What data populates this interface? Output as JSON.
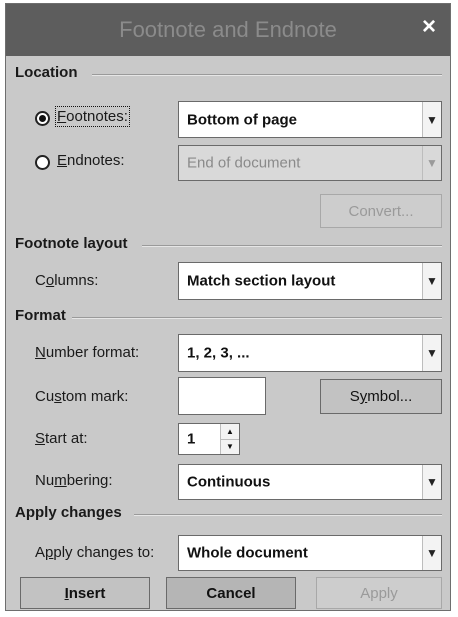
{
  "dialog": {
    "title": "Footnote and Endnote",
    "close_glyph": "×"
  },
  "location": {
    "section_label": "Location",
    "footnotes": {
      "label_first": "F",
      "label_rest": "ootnotes:",
      "selected": true,
      "value": "Bottom of page"
    },
    "endnotes": {
      "label_first": "E",
      "label_rest": "ndnotes:",
      "selected": false,
      "value": "End of document"
    },
    "convert_label": "Convert..."
  },
  "footnote_layout": {
    "section_label": "Footnote layout",
    "columns_label_first": "C",
    "columns_label_u": "o",
    "columns_label_rest": "lumns:",
    "columns_value": "Match section layout"
  },
  "format": {
    "section_label": "Format",
    "number_format_label_first": "N",
    "number_format_label_rest": "umber format:",
    "number_format_value": "1, 2, 3, ...",
    "custom_mark_label_first": "Cu",
    "custom_mark_label_u": "s",
    "custom_mark_label_rest": "tom mark:",
    "custom_mark_value": "",
    "symbol_label_first": "S",
    "symbol_label_u": "y",
    "symbol_label_rest": "mbol...",
    "start_at_label_first": "S",
    "start_at_label_rest": "tart at:",
    "start_at_value": "1",
    "numbering_label_first": "Nu",
    "numbering_label_u": "m",
    "numbering_label_rest": "bering:",
    "numbering_value": "Continuous"
  },
  "apply_changes": {
    "section_label": "Apply changes",
    "apply_to_label_first": "A",
    "apply_to_label_u": "p",
    "apply_to_label_rest": "ply changes to:",
    "apply_to_value": "Whole document"
  },
  "buttons": {
    "insert_first": "I",
    "insert_rest": "nsert",
    "cancel": "Cancel",
    "apply": "Apply"
  },
  "icons": {
    "dropdown": "chevron-down-icon",
    "spin_up": "arrow-up-icon",
    "spin_down": "arrow-down-icon",
    "close": "close-icon"
  }
}
